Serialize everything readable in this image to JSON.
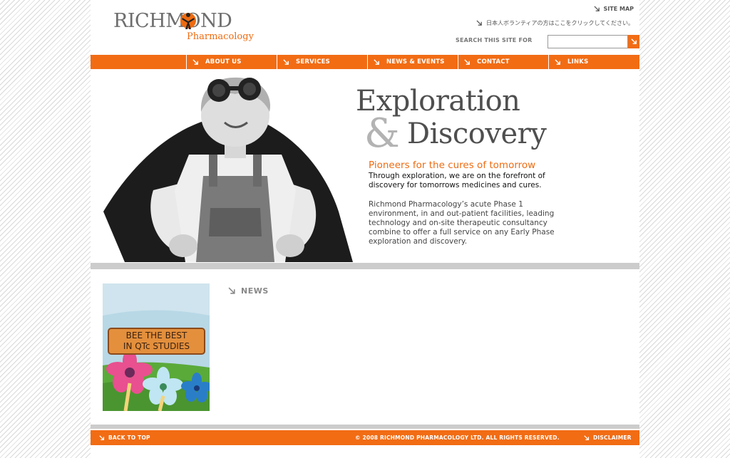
{
  "header": {
    "logo_main": "RICHMOND",
    "logo_sub": "Pharmacology",
    "sitemap_label": "SITE MAP",
    "japanese_link": "日本人ボランティアの方はここをクリックしてください。",
    "search_label": "SEARCH THIS SITE FOR",
    "search_value": ""
  },
  "nav": {
    "items": [
      {
        "label": "ABOUT US"
      },
      {
        "label": "SERVICES"
      },
      {
        "label": "NEWS & EVENTS"
      },
      {
        "label": "CONTACT"
      },
      {
        "label": "LINKS"
      }
    ]
  },
  "hero": {
    "title_line1": "Exploration",
    "title_amp": "&",
    "title_line2": "Discovery",
    "tagline": "Pioneers for the cures of tomorrow",
    "lead": "Through exploration, we are on the forefront of discovery for tomorrows medicines and cures.",
    "body": "Richmond Pharmacology’s acute Phase 1 environment, in and out-patient facilities, leading technology and on-site therapeutic consultancy combine to offer a full service on any Early Phase exploration and discovery."
  },
  "promo": {
    "line1": "BEE THE BEST",
    "line2": "IN QTc STUDIES"
  },
  "news": {
    "heading": "NEWS"
  },
  "footer": {
    "back_to_top": "BACK TO TOP",
    "copyright": "© 2008 RICHMOND PHARMACOLOGY LTD. ALL RIGHTS RESERVED.",
    "disclaimer": "DISCLAIMER"
  },
  "colors": {
    "accent": "#f26c14",
    "text_grey": "#4f4f4f",
    "band_grey": "#cccccc"
  },
  "icons": {
    "arrow": "arrow-down-right-icon",
    "logo_figure": "person-figure-icon"
  }
}
